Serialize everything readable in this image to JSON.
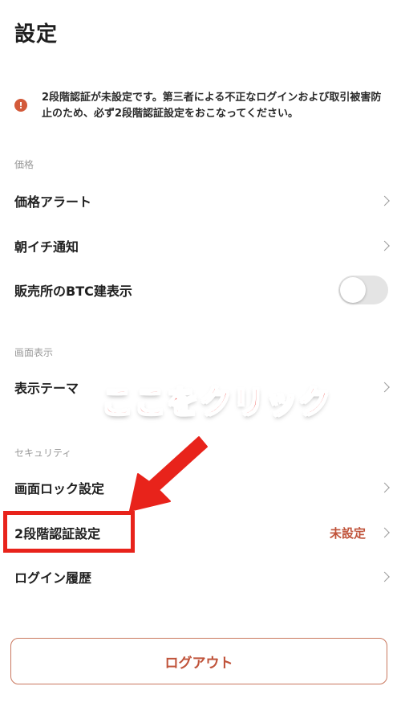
{
  "page": {
    "title": "設定"
  },
  "warning": {
    "icon": "alert-circle-icon",
    "text": "2段階認証が未設定です。第三者による不正なログインおよび取引被害防止のため、必ず2段階認証設定をおこなってください。",
    "color": "#d35a3a"
  },
  "sections": {
    "price": {
      "label": "価格",
      "items": [
        {
          "label": "価格アラート",
          "icon": "chevron-right-icon"
        },
        {
          "label": "朝イチ通知",
          "icon": "chevron-right-icon"
        },
        {
          "label": "販売所のBTC建表示",
          "toggle_on": false
        }
      ]
    },
    "display": {
      "label": "画面表示",
      "items": [
        {
          "label": "表示テーマ",
          "icon": "chevron-right-icon"
        }
      ]
    },
    "security": {
      "label": "セキュリティ",
      "items": [
        {
          "label": "画面ロック設定",
          "icon": "chevron-right-icon"
        },
        {
          "label": "2段階認証設定",
          "status": "未設定",
          "icon": "chevron-right-icon"
        },
        {
          "label": "ログイン履歴",
          "icon": "chevron-right-icon"
        }
      ]
    }
  },
  "annotation": {
    "callout_text": "ここをクリック",
    "color": "#e8231b"
  },
  "logout": {
    "label": "ログアウト",
    "color": "#c0533a"
  }
}
